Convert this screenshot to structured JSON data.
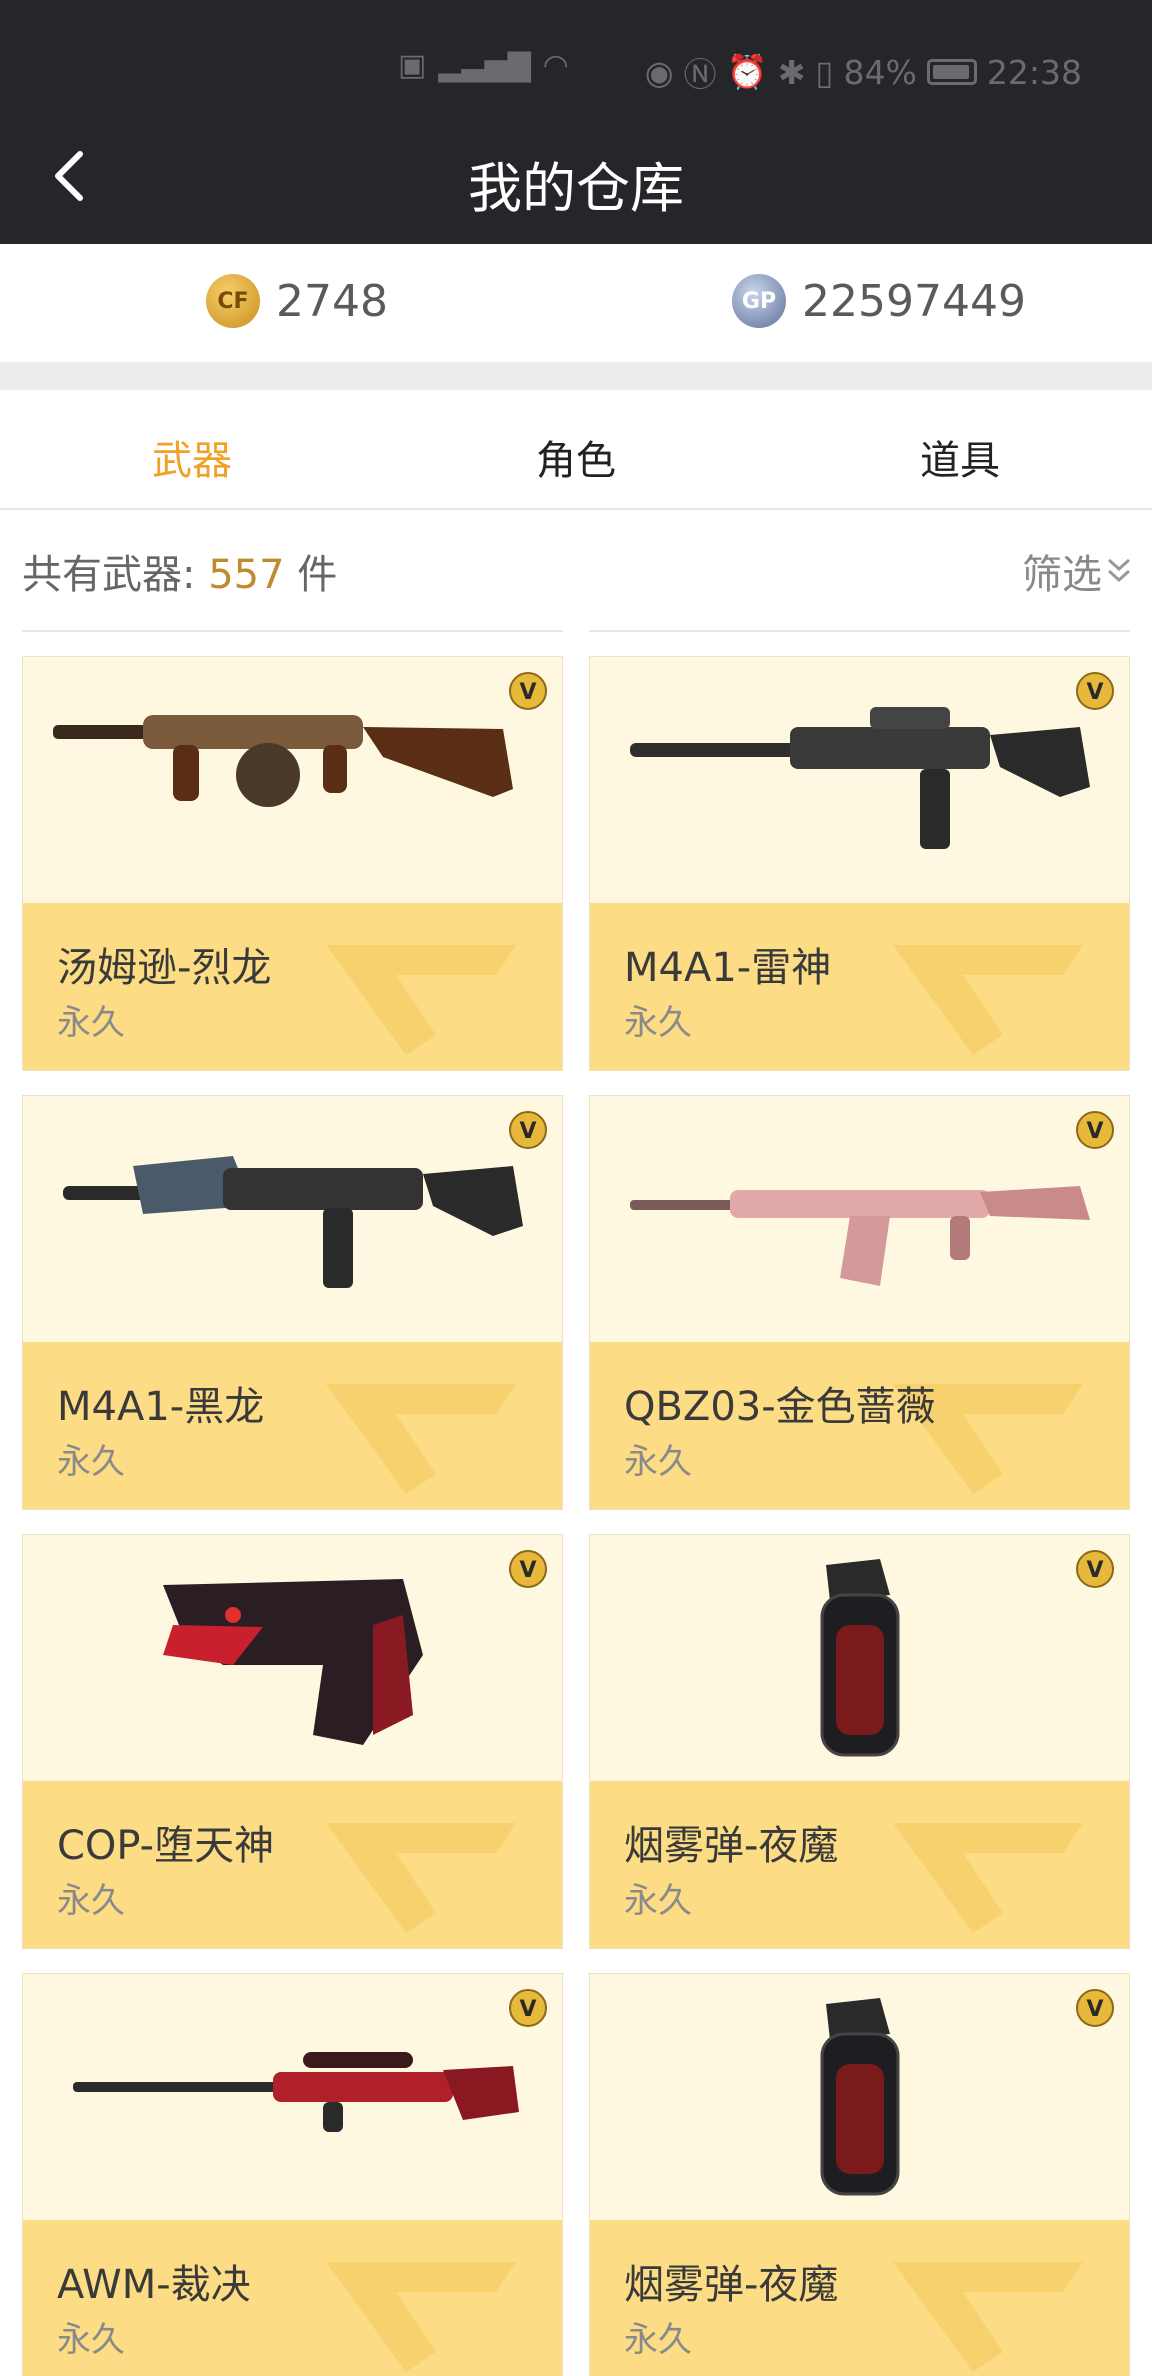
{
  "status_bar": {
    "left_icons": [
      "nfc-icon",
      "5g-signal-icon",
      "wifi-icon"
    ],
    "right_icons": [
      "eye-icon",
      "n-icon",
      "alarm-icon",
      "bluetooth-icon",
      "vibrate-icon"
    ],
    "battery": "84%",
    "time": "22:38"
  },
  "nav": {
    "title": "我的仓库"
  },
  "currency": {
    "cf_points": "2748",
    "gp_points": "22597449",
    "cf_icon_text": "CF",
    "gp_icon_text": "GP"
  },
  "tabs": [
    "武器",
    "角色",
    "道具"
  ],
  "active_tab": 0,
  "count": {
    "label": "共有武器:",
    "value": "557",
    "unit": "件"
  },
  "filter": {
    "label": "筛选"
  },
  "items": [
    {
      "name": "汤姆逊-烈龙",
      "duration": "永久"
    },
    {
      "name": "M4A1-雷神",
      "duration": "永久"
    },
    {
      "name": "M4A1-黑龙",
      "duration": "永久"
    },
    {
      "name": "QBZ03-金色蔷薇",
      "duration": "永久"
    },
    {
      "name": "COP-堕天神",
      "duration": "永久"
    },
    {
      "name": "烟雾弹-夜魔",
      "duration": "永久"
    },
    {
      "name": "AWM-裁决",
      "duration": "永久"
    },
    {
      "name": "烟雾弹-夜魔",
      "duration": "永久"
    }
  ],
  "colors": {
    "accent": "#f0a226",
    "card_info_bg": "#fcdd85",
    "card_image_bg": "#fff8e1",
    "navbar": "#25262a"
  }
}
